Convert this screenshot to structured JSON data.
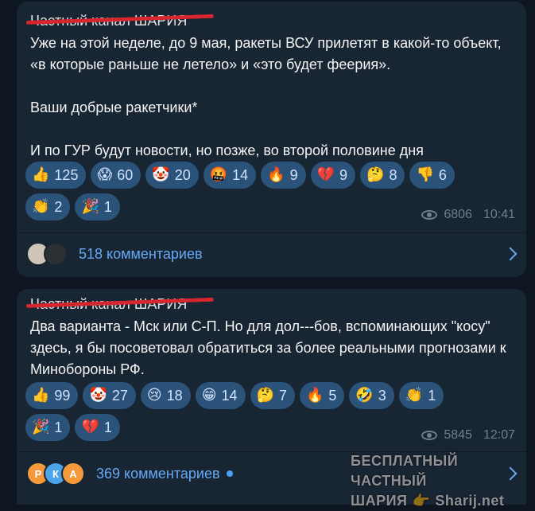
{
  "posts": [
    {
      "channel": "Частный канал ШАРИЯ",
      "paragraphs": [
        "Уже на этой неделе, до 9 мая, ракеты ВСУ прилетят в какой-то объект, «в которые раньше не летело» и «это будет феерия».",
        "Ваши добрые ракетчики*",
        "И по ГУР будут новости, но позже, во второй половине дня"
      ],
      "reactions": [
        {
          "emoji": "👍",
          "count": "125"
        },
        {
          "emoji": "😱",
          "count": "60"
        },
        {
          "emoji": "🤡",
          "count": "20"
        },
        {
          "emoji": "🤬",
          "count": "14"
        },
        {
          "emoji": "🔥",
          "count": "9"
        },
        {
          "emoji": "💔",
          "count": "9"
        },
        {
          "emoji": "🤔",
          "count": "8"
        },
        {
          "emoji": "👎",
          "count": "6"
        },
        {
          "emoji": "👏",
          "count": "2"
        },
        {
          "emoji": "🎉",
          "count": "1"
        }
      ],
      "views": "6806",
      "time": "10:41",
      "comments_label": "518 комментариев"
    },
    {
      "channel": "Частный канал ШАРИЯ",
      "paragraphs": [
        "Два варианта - Мск или С-П. Но для дол---бов, вспоминающих \"косу\" здесь, я бы посоветовал обратиться за более реальными прогнозами к Минобороны РФ."
      ],
      "reactions": [
        {
          "emoji": "👍",
          "count": "99"
        },
        {
          "emoji": "🤡",
          "count": "27"
        },
        {
          "emoji": "😢",
          "count": "18"
        },
        {
          "emoji": "😁",
          "count": "14"
        },
        {
          "emoji": "🤔",
          "count": "7"
        },
        {
          "emoji": "🔥",
          "count": "5"
        },
        {
          "emoji": "🤣",
          "count": "3"
        },
        {
          "emoji": "👏",
          "count": "1"
        },
        {
          "emoji": "🎉",
          "count": "1"
        },
        {
          "emoji": "💔",
          "count": "1"
        }
      ],
      "views": "5845",
      "time": "12:07",
      "comments_label": "369 комментариев",
      "avatars": [
        "Р",
        "К",
        "А"
      ]
    }
  ],
  "watermark": {
    "line1": "БЕСПЛАТНЫЙ ЧАСТНЫЙ",
    "line2a": "ШАРИЯ",
    "line2b": "Sharij.net"
  },
  "colors": {
    "background": "#0e1621",
    "bubble": "#182533",
    "reaction_chip": "#2b5278",
    "link": "#66aaf5",
    "strike": "#d7262d"
  }
}
